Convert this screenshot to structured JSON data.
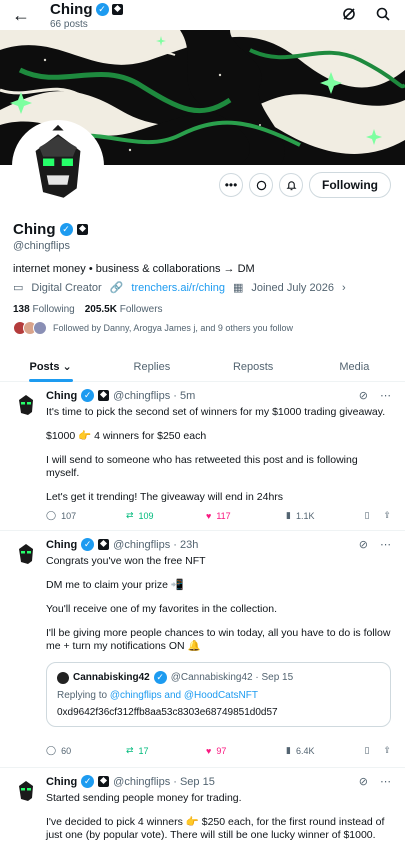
{
  "header": {
    "name": "Ching",
    "post_count": "66 posts"
  },
  "profile": {
    "name": "Ching",
    "handle": "@chingflips",
    "bio": "internet money • business & collaborations → DM",
    "category": "Digital Creator",
    "link": "trenchers.ai/r/ching",
    "joined": "Joined July 2026",
    "following_count": "138",
    "following_label": "Following",
    "followers_count": "205.5K",
    "followers_label": "Followers",
    "followed_by": "Followed by Danny, Arogya James j, and 9 others you follow",
    "follow_button": "Following"
  },
  "tabs": [
    {
      "label": "Posts"
    },
    {
      "label": "Replies"
    },
    {
      "label": "Reposts"
    },
    {
      "label": "Media"
    }
  ],
  "posts": [
    {
      "name": "Ching",
      "handle_time": "@chingflips · 5m",
      "lines": [
        "It's time to pick the second set of winners for my $1000 trading giveaway.",
        "$1000 👉 4 winners for $250 each",
        "I will send to someone who has retweeted this post and is following myself.",
        "Let's get it trending! The giveaway will end in 24hrs"
      ],
      "replies": "107",
      "reposts": "109",
      "likes": "117",
      "views": "1.1K"
    },
    {
      "name": "Ching",
      "handle_time": "@chingflips · 23h",
      "lines": [
        "Congrats you've won the free NFT",
        "DM me to claim your prize 📲",
        "You'll receive one of my favorites in the collection.",
        "I'll be giving more people chances to win today, all you have to do is follow me + turn my notifications ON 🔔"
      ],
      "quote": {
        "name": "Cannabisking42",
        "handle_time": "@Cannabisking42 · Sep 15",
        "replying_prefix": "Replying to",
        "replying_to": "@chingflips and @HoodCatsNFT",
        "text": "0xd9642f36cf312ffb8aa53c8303e68749851d0d57"
      },
      "replies": "60",
      "reposts": "17",
      "likes": "97",
      "views": "6.4K"
    },
    {
      "name": "Ching",
      "handle_time": "@chingflips · Sep 15",
      "lines": [
        "Started sending people money for trading.",
        "I've decided to pick 4 winners 👉 $250 each, for the first round instead of just one (by popular vote). There will still be one lucky winner of $1000."
      ]
    }
  ]
}
